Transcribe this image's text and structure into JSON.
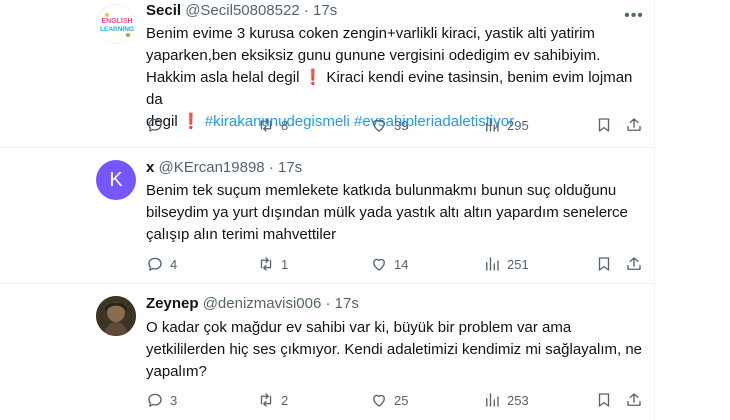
{
  "tweets": [
    {
      "name": "Secil",
      "handle": "@Secil50808522",
      "time": "17s",
      "avatar_text": "ENGLISH\nLEARNING",
      "text_lines": [
        "Benim evime 3 kurusa coken zengin+varlikli kiraci, yastik alti yatirim",
        "yaparken,ben eksiksiz gunu gunune vergisini odedigim ev sahibiyim.",
        "Hakkim asla helal degil",
        " Kiraci kendi evine tasinsin, benim evim lojman da",
        "degil",
        "#kirakanunudegismeli",
        "#evsahipleriadaletistiyor"
      ],
      "excl": "❗",
      "replies": "",
      "retweets": "8",
      "likes": "39",
      "views": "295"
    },
    {
      "name": "x",
      "handle": "@KErcan19898",
      "time": "17s",
      "avatar_text": "K",
      "avatar_color": "#7856ff",
      "text_lines": [
        "Benim tek suçum memlekete katkıda bulunmakmı bunun suç olduğunu",
        "bilseydim ya yurt dışından mülk yada yastık altı altın yapardım senelerce",
        "çalışıp alın terimi mahvettiler"
      ],
      "replies": "4",
      "retweets": "1",
      "likes": "14",
      "views": "251"
    },
    {
      "name": "Zeynep",
      "handle": "@denizmavisi006",
      "time": "17s",
      "text_lines": [
        "O kadar çok mağdur ev sahibi var ki, büyük bir problem var ama",
        "yetkililerden hiç ses çıkmıyor. Kendi adaletimizi kendimiz mi sağlayalım, ne",
        "yapalım?"
      ],
      "replies": "3",
      "retweets": "2",
      "likes": "25",
      "views": "253"
    }
  ],
  "separator": "·",
  "colors": {
    "hashtag": "#1d9bf0",
    "muted": "#536471",
    "k_avatar": "#7856ff"
  }
}
